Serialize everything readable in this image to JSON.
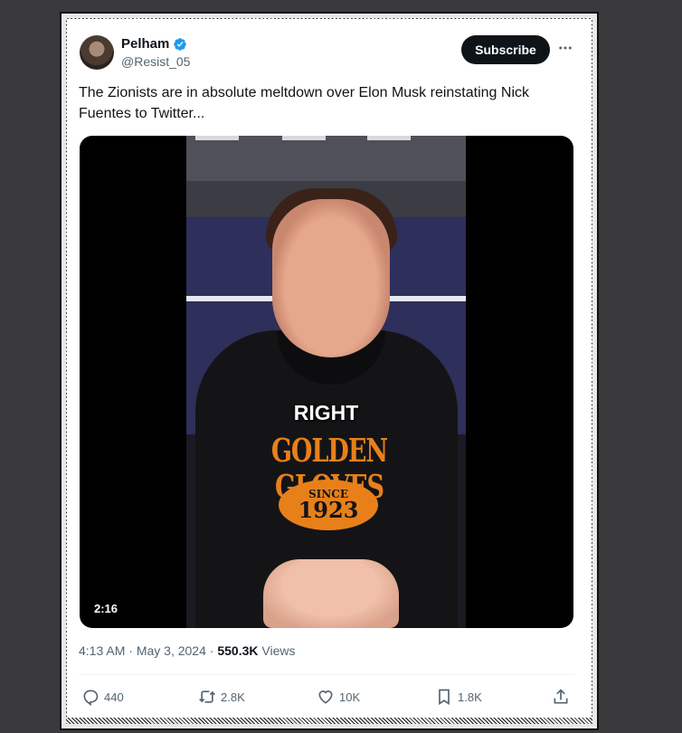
{
  "tweet": {
    "author": {
      "name": "Pelham",
      "handle": "@Resist_05",
      "verified_color": "#1d9bf0"
    },
    "subscribe_label": "Subscribe",
    "more_icon": "more-horizontal-icon",
    "text": "The Zionists are in absolute meltdown over Elon Musk reinstating Nick Fuentes to Twitter...",
    "media": {
      "type": "video",
      "caption": "RIGHT",
      "duration": "2:16",
      "hoodie_print": "GOLDEN GLOVES",
      "badge_line1": "SINCE",
      "badge_line2": "1923"
    },
    "time": "4:13 AM",
    "separator": "·",
    "date": "May 3, 2024",
    "views_count": "550.3K",
    "views_label": "Views",
    "actions": {
      "replies": "440",
      "reposts": "2.8K",
      "likes": "10K",
      "bookmarks": "1.8K"
    }
  },
  "colors": {
    "text_primary": "#0f1419",
    "text_secondary": "#536471",
    "accent": "#1d9bf0",
    "button_bg": "#0f1419"
  }
}
